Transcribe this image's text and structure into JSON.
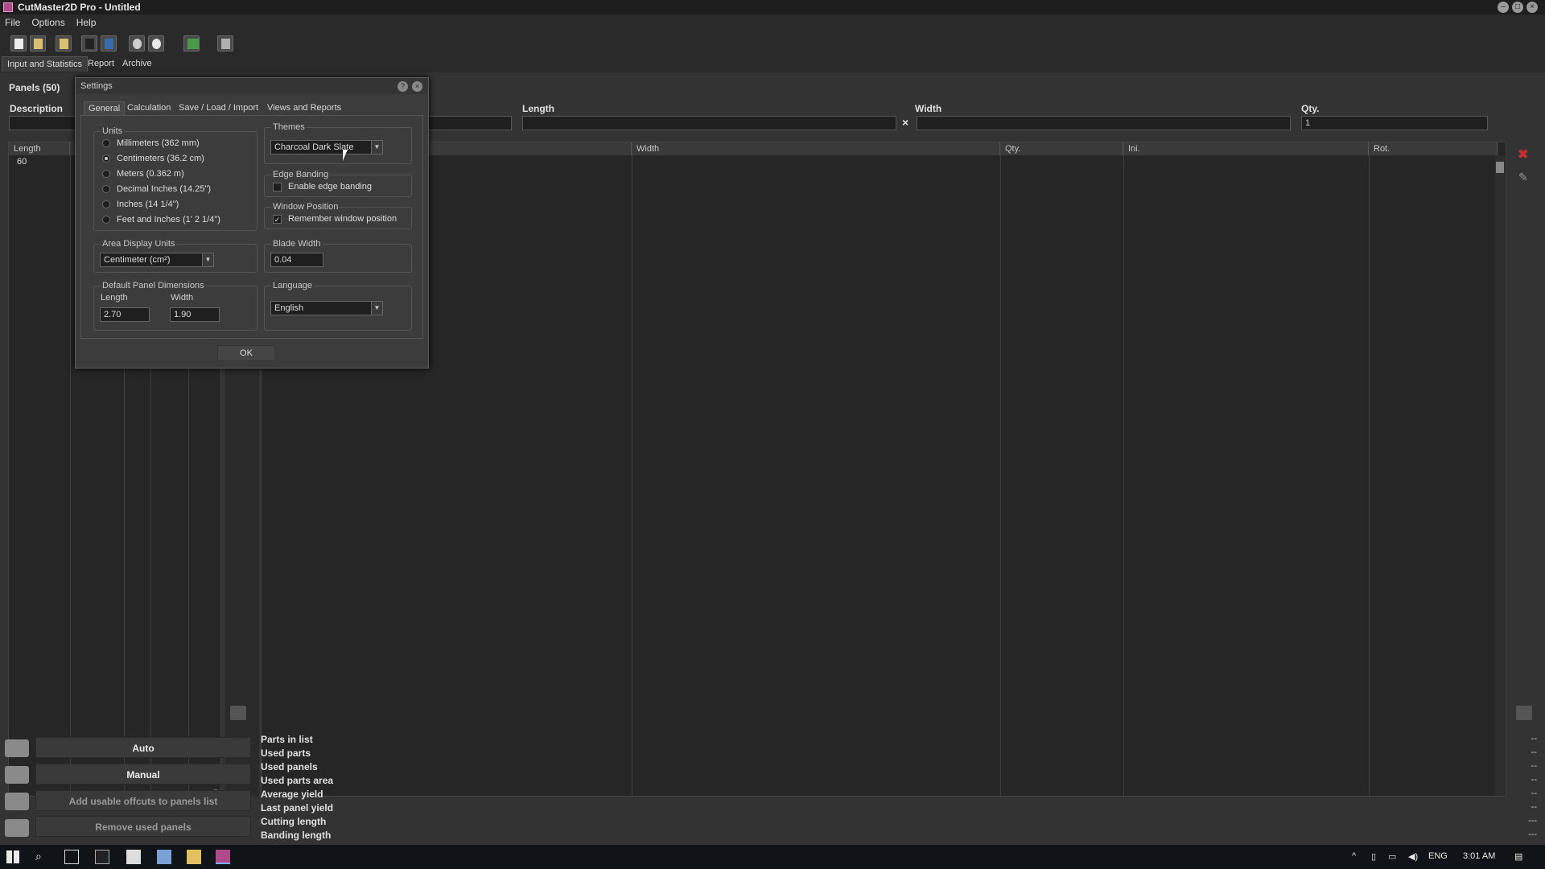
{
  "window": {
    "title": "CutMaster2D Pro - Untitled",
    "controls": [
      "minimize-icon",
      "maximize-icon",
      "close-icon"
    ]
  },
  "menu": [
    "File",
    "Options",
    "Help"
  ],
  "page_tabs": [
    "Input and Statistics",
    "Report",
    "Archive"
  ],
  "panels": {
    "header": "Panels (50)",
    "grid_headers": [
      "Length"
    ],
    "rows": [
      [
        "60"
      ]
    ]
  },
  "parts": {
    "headers": [
      "Description",
      "Length",
      "Width",
      "Qty."
    ],
    "qty_default": "1",
    "grid_headers": [
      "Width",
      "Qty.",
      "Ini.",
      "Rot."
    ]
  },
  "actions": [
    {
      "label": "Auto",
      "enabled": true
    },
    {
      "label": "Manual",
      "enabled": true
    },
    {
      "label": "Add usable offcuts to panels list",
      "enabled": false
    },
    {
      "label": "Remove used panels",
      "enabled": false
    }
  ],
  "stats": [
    {
      "label": "Parts in list",
      "value": "--"
    },
    {
      "label": "Used parts",
      "value": "--"
    },
    {
      "label": "Used panels",
      "value": "--"
    },
    {
      "label": "Used parts area",
      "value": "--"
    },
    {
      "label": "Average yield",
      "value": "--"
    },
    {
      "label": "Last panel yield",
      "value": "--"
    },
    {
      "label": "Cutting length",
      "value": "---"
    },
    {
      "label": "Banding length",
      "value": "---"
    }
  ],
  "dialog": {
    "title": "Settings",
    "tabs": [
      "General",
      "Calculation",
      "Save / Load / Import",
      "Views and Reports"
    ],
    "active_tab": "General",
    "units": {
      "label": "Units",
      "options": [
        "Millimeters (362 mm)",
        "Centimeters (36.2 cm)",
        "Meters (0.362 m)",
        "Decimal Inches (14.25\")",
        "Inches (14 1/4\")",
        "Feet and Inches (1' 2 1/4\")"
      ],
      "selected": "Centimeters (36.2 cm)"
    },
    "area_units": {
      "label": "Area Display Units",
      "value": "Centimeter (cm²)"
    },
    "default_dims": {
      "label": "Default Panel Dimensions",
      "length_label": "Length",
      "width_label": "Width",
      "length": "2.70",
      "width": "1.90"
    },
    "themes": {
      "label": "Themes",
      "value": "Charcoal Dark Slate"
    },
    "edge_banding": {
      "label": "Edge Banding",
      "option": "Enable edge banding",
      "checked": false
    },
    "window_position": {
      "label": "Window Position",
      "option": "Remember window position",
      "checked": true
    },
    "blade_width": {
      "label": "Blade Width",
      "value": "0.04"
    },
    "language": {
      "label": "Language",
      "value": "English"
    },
    "ok": "OK"
  },
  "taskbar": {
    "lang": "ENG",
    "time": "3:01 AM"
  }
}
